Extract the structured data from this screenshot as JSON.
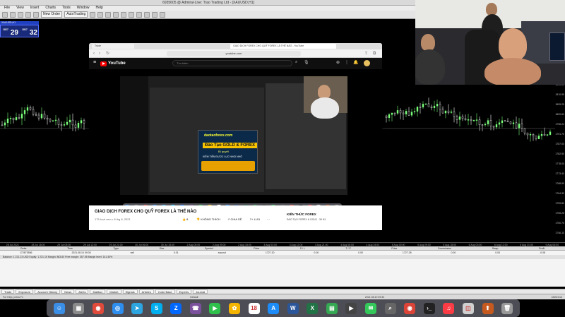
{
  "mt4": {
    "title": "6935605 @ Admiral-Live: Trao Trading Ltd - [XAUUSD,H1]",
    "menu": [
      "File",
      "View",
      "Insert",
      "Charts",
      "Tools",
      "Window",
      "Help"
    ],
    "toolbar": {
      "new_order_label": "New Order",
      "autotrading_label": "AutoTrading"
    },
    "one_click": {
      "symbol": "XAUUSD,H1",
      "sell_label": "SELL",
      "buy_label": "BUY",
      "sell_price": "29",
      "buy_price": "32",
      "sell_prefix": "1827",
      "buy_prefix": "1827",
      "lot": "0.01"
    },
    "price_ticks": [
      "1815.55",
      "1810.55",
      "1805.25",
      "1800.60",
      "1796.24",
      "1791.70",
      "1787.00",
      "1782.50",
      "1778.00",
      "1773.40",
      "1768.90",
      "1764.30",
      "1759.80",
      "1755.25",
      "1750.70",
      "1746.10"
    ],
    "time_ticks": [
      "28 Jul 2021",
      "28 Jul 18:00",
      "29 Jul 03:00",
      "29 Jul 12:00",
      "29 Jul 21:00",
      "30 Jul 06:00",
      "30 Jul 15:00",
      "2 Aug 00:00",
      "2 Aug 09:00",
      "2 Aug 18:00",
      "3 Aug 03:00",
      "3 Aug 12:00",
      "3 Aug 21:00",
      "4 Aug 06:00",
      "4 Aug 15:00",
      "5 Aug 00:00",
      "5 Aug 09:00",
      "5 Aug 18:00",
      "6 Aug 03:00",
      "6 Aug 12:00",
      "6 Aug 21:00",
      "9 Aug 06:00"
    ]
  },
  "terminal": {
    "headers": [
      "Order",
      "Time",
      "Type",
      "Size",
      "Symbol",
      "Price",
      "S / L",
      "T / P",
      "Price",
      "Commission",
      "Swap",
      "Profit"
    ],
    "row": [
      "172873556",
      "2021.08.10 09:30",
      "sell",
      "0.01",
      "xauusd",
      "1727.20",
      "0.00",
      "0.00",
      "1727.28",
      "0.00",
      "0.00",
      "-0.08"
    ],
    "balance_line": "Balance: 1 221.23 USD  Equity: 1 221.15  Margin: 863.60  Free margin: 357.55  Margin level: 141.40%",
    "tabs": [
      "Trade",
      "Exposure",
      "Account History",
      "News",
      "Alerts",
      "Mailbox",
      "Market",
      "Signals",
      "Articles",
      "Code Base",
      "Experts",
      "Journal"
    ],
    "status_left": "For Help, press F1",
    "status_mid": "Default",
    "status_right": "2021.08.10 09:30 ",
    "status_conn": "1825/4 kb"
  },
  "browser": {
    "tab1": "GIAO DỊCH FOREX CHO QUỸ FOREX LÀ THẾ NÀO - YouTube",
    "tab2": "Trade",
    "url": "youtube.com",
    "yt_logo": "YouTube",
    "search_placeholder": "Tìm kiếm",
    "video_title": "GIAO DỊCH FOREX CHO QUỸ FOREX LÀ THẾ NÀO",
    "video_meta": "175 lượt xem • 8 thg 8, 2021",
    "likes": "8",
    "dislike_label": "KHÔNG THÍCH",
    "share_label": "CHIA SẺ",
    "save_label": "LƯU",
    "channel_name": "KIẾN THỨC FOREX",
    "channel_sub": "ĐÀO TẠO FOREX & GOLD · 39 N1"
  },
  "promo": {
    "site": "daotaoforex.com",
    "title": "Đào Tạo GOLD & FOREX",
    "subtitle": "Bí quyết",
    "tagline": "KIẾM TIỀN ĐƯỢC LỤC NHỌI NHỎ"
  },
  "dock": {
    "icons": [
      "finder-icon",
      "launchpad-icon",
      "chrome-icon",
      "safari-icon",
      "telegram-icon",
      "skype-icon",
      "zalo-icon",
      "viber-icon",
      "facetime-icon",
      "photos-icon",
      "calendar-icon",
      "appstore-icon",
      "word-icon",
      "excel-icon",
      "numbers-icon",
      "quicktime-icon",
      "messages-icon",
      "spotlight-icon",
      "chrome2-icon",
      "terminal-icon",
      "itunes-icon",
      "preview-icon",
      "mt4-icon",
      "trash-icon"
    ],
    "colors": [
      "#3a8ee6",
      "#8a8a8a",
      "#e04a3b",
      "#2e8ef0",
      "#2ca5e0",
      "#00aff0",
      "#0068ff",
      "#7b519d",
      "#2fc14c",
      "#f4b400",
      "#ffffff",
      "#1d8cf8",
      "#2b579a",
      "#217346",
      "#35a853",
      "#444",
      "#34c759",
      "#666",
      "#db4437",
      "#222",
      "#fc3c44",
      "#d0d0d0",
      "#c65a1e",
      "#999"
    ],
    "glyphs": [
      "☺",
      "▦",
      "◉",
      "◎",
      "➤",
      "S",
      "Z",
      "☎",
      "▶",
      "✿",
      "18",
      "A",
      "W",
      "X",
      "▤",
      "▶",
      "✉",
      "⌕",
      "◉",
      "›_",
      "♫",
      "◫",
      "⬆",
      "🗑"
    ]
  },
  "colors": {
    "candle_up": "#7aff7a",
    "candle_down": "#ffffff",
    "otp_bg": "#1a2a7a",
    "yt_red": "#ff0000"
  }
}
